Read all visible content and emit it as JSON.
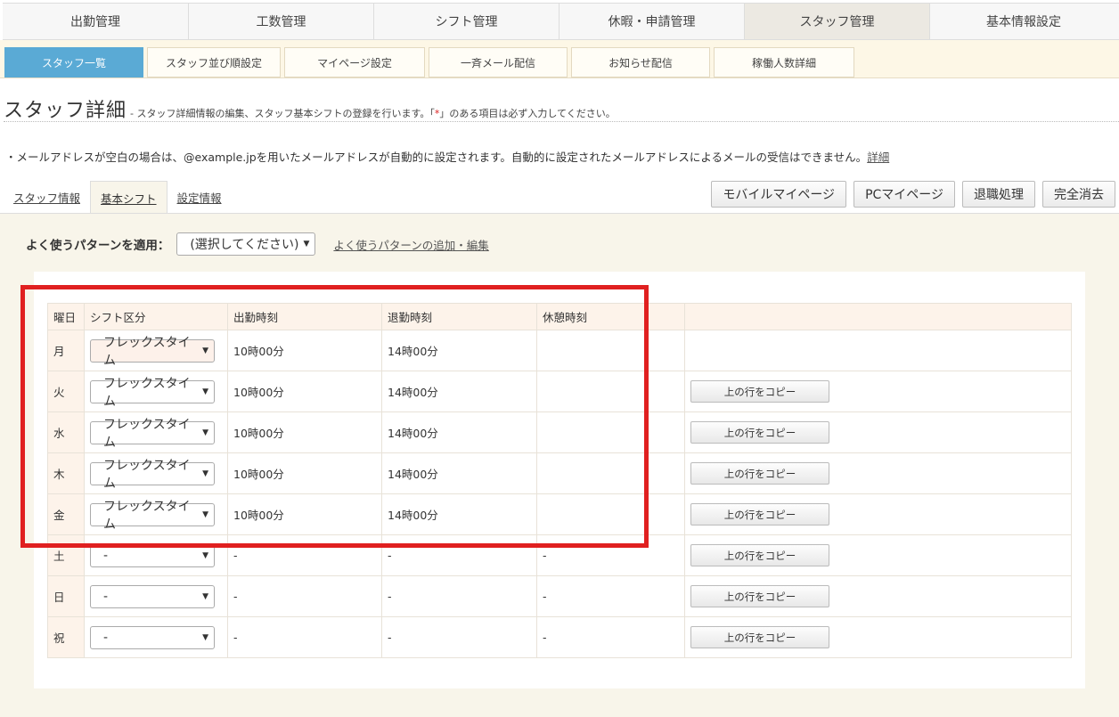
{
  "top_nav": [
    {
      "label": "出勤管理",
      "active": false
    },
    {
      "label": "工数管理",
      "active": false
    },
    {
      "label": "シフト管理",
      "active": false
    },
    {
      "label": "休暇・申請管理",
      "active": false
    },
    {
      "label": "スタッフ管理",
      "active": true
    },
    {
      "label": "基本情報設定",
      "active": false
    }
  ],
  "sub_nav": [
    {
      "label": "スタッフ一覧",
      "active": true
    },
    {
      "label": "スタッフ並び順設定",
      "active": false
    },
    {
      "label": "マイページ設定",
      "active": false
    },
    {
      "label": "一斉メール配信",
      "active": false
    },
    {
      "label": "お知らせ配信",
      "active": false
    },
    {
      "label": "稼働人数詳細",
      "active": false
    }
  ],
  "page": {
    "title": "スタッフ詳細",
    "description_pre": "- スタッフ詳細情報の編集、スタッフ基本シフトの登録を行います。「",
    "required_mark": "*",
    "description_post": "」のある項目は必ず入力してください。",
    "notice": "・メールアドレスが空白の場合は、@example.jpを用いたメールアドレスが自動的に設定されます。自動的に設定されたメールアドレスによるメールの受信はできません。",
    "notice_link": "詳細"
  },
  "tabs": [
    {
      "label": "スタッフ情報",
      "active": false
    },
    {
      "label": "基本シフト",
      "active": true
    },
    {
      "label": "設定情報",
      "active": false
    }
  ],
  "actions": {
    "mobile_mypage": "モバイルマイページ",
    "pc_mypage": "PCマイページ",
    "retire": "退職処理",
    "delete": "完全消去"
  },
  "pattern": {
    "label": "よく使うパターンを適用：",
    "selected": "(選択してください)",
    "edit_link": "よく使うパターンの追加・編集"
  },
  "table": {
    "headers": [
      "曜日",
      "シフト区分",
      "出勤時刻",
      "退勤時刻",
      "休憩時刻",
      ""
    ],
    "copy_label": "上の行をコピー",
    "rows": [
      {
        "day": "月",
        "shift": "フレックスタイム",
        "start": "10時00分",
        "end": "14時00分",
        "break": ""
      },
      {
        "day": "火",
        "shift": "フレックスタイム",
        "start": "10時00分",
        "end": "14時00分",
        "break": ""
      },
      {
        "day": "水",
        "shift": "フレックスタイム",
        "start": "10時00分",
        "end": "14時00分",
        "break": ""
      },
      {
        "day": "木",
        "shift": "フレックスタイム",
        "start": "10時00分",
        "end": "14時00分",
        "break": ""
      },
      {
        "day": "金",
        "shift": "フレックスタイム",
        "start": "10時00分",
        "end": "14時00分",
        "break": ""
      },
      {
        "day": "土",
        "shift": "-",
        "start": "-",
        "end": "-",
        "break": "-"
      },
      {
        "day": "日",
        "shift": "-",
        "start": "-",
        "end": "-",
        "break": "-"
      },
      {
        "day": "祝",
        "shift": "-",
        "start": "-",
        "end": "-",
        "break": "-"
      }
    ]
  },
  "colors": {
    "accent": "#5aaad5",
    "highlight": "#e02020",
    "panel": "#f8f5ea",
    "table_header": "#fdf3ea"
  }
}
